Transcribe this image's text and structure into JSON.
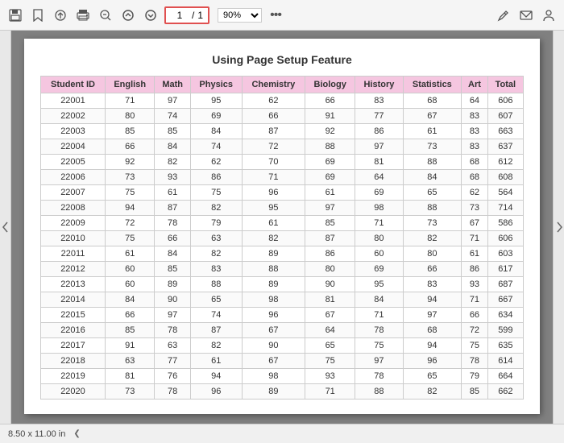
{
  "toolbar": {
    "page_current": "1",
    "page_total": "1",
    "zoom": "90%",
    "more_label": "..."
  },
  "page": {
    "title": "Using Page Setup Feature",
    "size": "8.50 x 11.00 in"
  },
  "table": {
    "headers": [
      "Student ID",
      "English",
      "Math",
      "Physics",
      "Chemistry",
      "Biology",
      "History",
      "Statistics",
      "Art",
      "Total"
    ],
    "rows": [
      [
        "22001",
        "71",
        "97",
        "95",
        "62",
        "66",
        "83",
        "68",
        "64",
        "606"
      ],
      [
        "22002",
        "80",
        "74",
        "69",
        "66",
        "91",
        "77",
        "67",
        "83",
        "607"
      ],
      [
        "22003",
        "85",
        "85",
        "84",
        "87",
        "92",
        "86",
        "61",
        "83",
        "663"
      ],
      [
        "22004",
        "66",
        "84",
        "74",
        "72",
        "88",
        "97",
        "73",
        "83",
        "637"
      ],
      [
        "22005",
        "92",
        "82",
        "62",
        "70",
        "69",
        "81",
        "88",
        "68",
        "612"
      ],
      [
        "22006",
        "73",
        "93",
        "86",
        "71",
        "69",
        "64",
        "84",
        "68",
        "608"
      ],
      [
        "22007",
        "75",
        "61",
        "75",
        "96",
        "61",
        "69",
        "65",
        "62",
        "564"
      ],
      [
        "22008",
        "94",
        "87",
        "82",
        "95",
        "97",
        "98",
        "88",
        "73",
        "714"
      ],
      [
        "22009",
        "72",
        "78",
        "79",
        "61",
        "85",
        "71",
        "73",
        "67",
        "586"
      ],
      [
        "22010",
        "75",
        "66",
        "63",
        "82",
        "87",
        "80",
        "82",
        "71",
        "606"
      ],
      [
        "22011",
        "61",
        "84",
        "82",
        "89",
        "86",
        "60",
        "80",
        "61",
        "603"
      ],
      [
        "22012",
        "60",
        "85",
        "83",
        "88",
        "80",
        "69",
        "66",
        "86",
        "617"
      ],
      [
        "22013",
        "60",
        "89",
        "88",
        "89",
        "90",
        "95",
        "83",
        "93",
        "687"
      ],
      [
        "22014",
        "84",
        "90",
        "65",
        "98",
        "81",
        "84",
        "94",
        "71",
        "667"
      ],
      [
        "22015",
        "66",
        "97",
        "74",
        "96",
        "67",
        "71",
        "97",
        "66",
        "634"
      ],
      [
        "22016",
        "85",
        "78",
        "87",
        "67",
        "64",
        "78",
        "68",
        "72",
        "599"
      ],
      [
        "22017",
        "91",
        "63",
        "82",
        "90",
        "65",
        "75",
        "94",
        "75",
        "635"
      ],
      [
        "22018",
        "63",
        "77",
        "61",
        "67",
        "75",
        "97",
        "96",
        "78",
        "614"
      ],
      [
        "22019",
        "81",
        "76",
        "94",
        "98",
        "93",
        "78",
        "65",
        "79",
        "664"
      ],
      [
        "22020",
        "73",
        "78",
        "96",
        "89",
        "71",
        "88",
        "82",
        "85",
        "662"
      ]
    ]
  },
  "icons": {
    "save": "💾",
    "bookmark": "☆",
    "upload": "⬆",
    "print": "🖨",
    "zoom_minus": "🔍",
    "zoom_up": "⬆",
    "zoom_down": "⬇",
    "more": "•••",
    "pen": "✏",
    "mail": "✉",
    "user": "👤",
    "left_arrow": "❮",
    "right_arrow": "❯",
    "nav_left": "<",
    "nav_right": ">"
  }
}
